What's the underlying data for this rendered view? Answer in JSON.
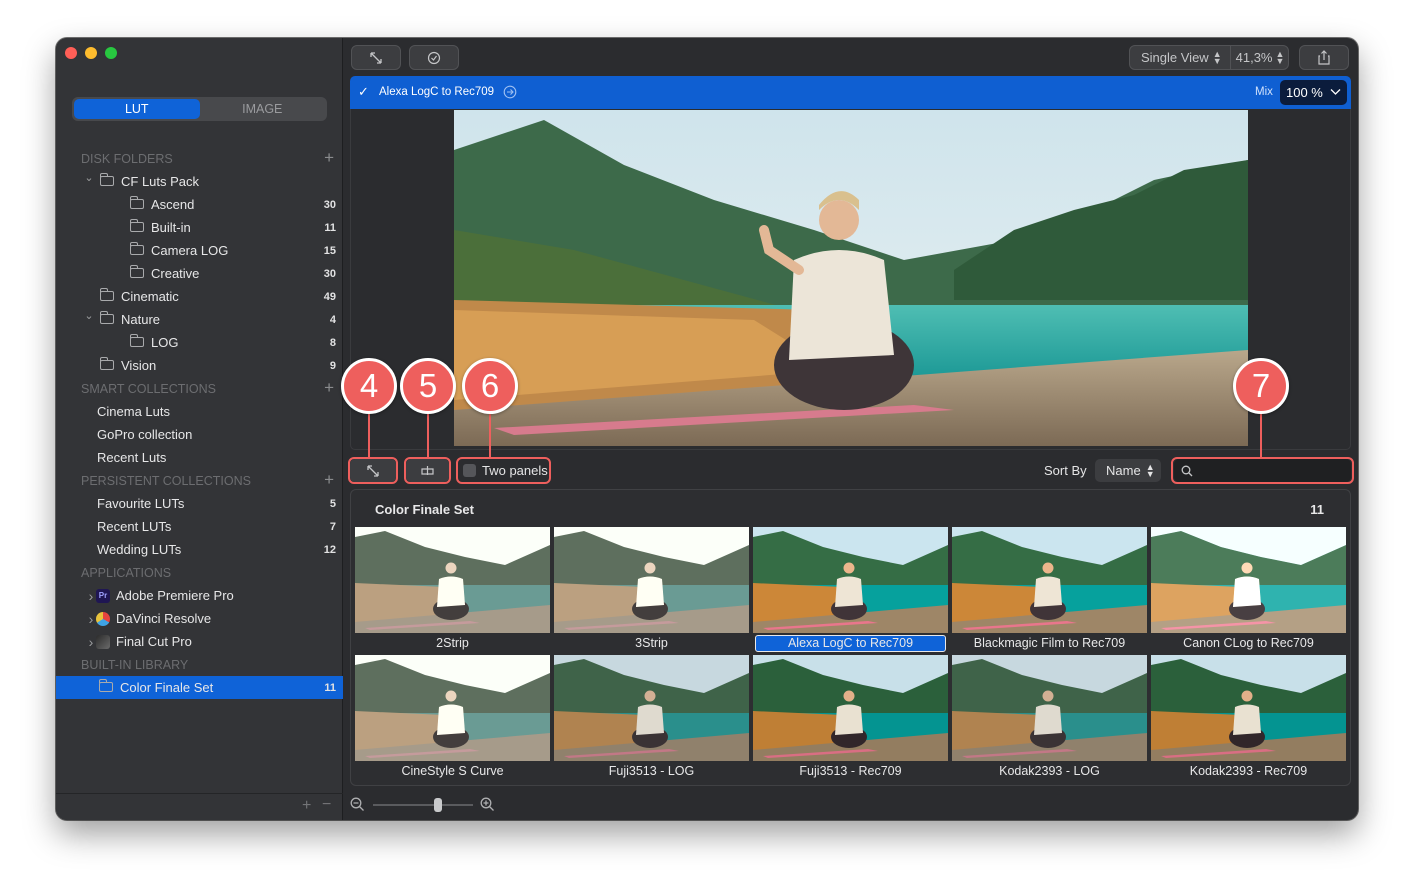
{
  "window": {
    "traffic_lights": [
      "#ff5f57",
      "#febc2e",
      "#28c840"
    ]
  },
  "mode": {
    "lut": "LUT",
    "image": "IMAGE",
    "selected": "LUT"
  },
  "sidebar": {
    "disk_folders": {
      "header": "DISK FOLDERS",
      "items": [
        {
          "label": "CF Luts Pack",
          "count": "",
          "level": 1,
          "disclosure": "open"
        },
        {
          "label": "Ascend",
          "count": "30",
          "level": 2,
          "disclosure": ""
        },
        {
          "label": "Built-in",
          "count": "11",
          "level": 2,
          "disclosure": ""
        },
        {
          "label": "Camera LOG",
          "count": "15",
          "level": 2,
          "disclosure": ""
        },
        {
          "label": "Creative",
          "count": "30",
          "level": 2,
          "disclosure": ""
        },
        {
          "label": "Cinematic",
          "count": "49",
          "level": 1,
          "disclosure": ""
        },
        {
          "label": "Nature",
          "count": "4",
          "level": 1,
          "disclosure": "open"
        },
        {
          "label": "LOG",
          "count": "8",
          "level": 2,
          "disclosure": ""
        },
        {
          "label": "Vision",
          "count": "9",
          "level": 1,
          "disclosure": ""
        }
      ]
    },
    "smart_collections": {
      "header": "SMART COLLECTIONS",
      "items": [
        {
          "label": "Cinema Luts"
        },
        {
          "label": "GoPro collection"
        },
        {
          "label": "Recent Luts"
        }
      ]
    },
    "persistent_collections": {
      "header": "PERSISTENT COLLECTIONS",
      "items": [
        {
          "label": "Favourite LUTs",
          "count": "5"
        },
        {
          "label": "Recent LUTs",
          "count": "7"
        },
        {
          "label": "Wedding LUTs",
          "count": "12"
        }
      ]
    },
    "applications": {
      "header": "APPLICATIONS",
      "items": [
        {
          "label": "Adobe Premiere Pro",
          "icon": "premiere-pro-icon",
          "badge": "Pr"
        },
        {
          "label": "DaVinci Resolve",
          "icon": "davinci-resolve-icon",
          "badge": ""
        },
        {
          "label": "Final Cut Pro",
          "icon": "final-cut-pro-icon",
          "badge": ""
        }
      ]
    },
    "built_in_library": {
      "header": "BUILT-IN LIBRARY",
      "items": [
        {
          "label": "Color Finale Set",
          "count": "11",
          "selected": true
        }
      ]
    },
    "footer": {
      "add": "+",
      "remove": "−"
    }
  },
  "toolbar": {
    "view_mode": "Single View",
    "zoom": "41,3%",
    "icons": [
      "fit-screen-icon",
      "compare-icon",
      "share-icon"
    ]
  },
  "active_lut": {
    "name": "Alexa LogC to Rec709",
    "enabled": true,
    "mix_label": "Mix",
    "mix_value": "100 %"
  },
  "preview_tools": {
    "two_panels_label": "Two panels",
    "two_panels_checked": false,
    "sort_by_label": "Sort By",
    "sort_value": "Name",
    "search_placeholder": ""
  },
  "callouts": [
    "4",
    "5",
    "6",
    "7"
  ],
  "gallery": {
    "title": "Color Finale Set",
    "count": "11",
    "items": [
      {
        "name": "2Strip",
        "tone": "faded"
      },
      {
        "name": "3Strip",
        "tone": "faded"
      },
      {
        "name": "Alexa LogC to Rec709",
        "tone": "vivid",
        "selected": true
      },
      {
        "name": "Blackmagic Film to Rec709",
        "tone": "vivid"
      },
      {
        "name": "Canon CLog to Rec709",
        "tone": "bright"
      },
      {
        "name": "CineStyle S Curve",
        "tone": "faded"
      },
      {
        "name": "Fuji3513 - LOG",
        "tone": "normal"
      },
      {
        "name": "Fuji3513 - Rec709",
        "tone": "contrast"
      },
      {
        "name": "Kodak2393 - LOG",
        "tone": "normal"
      },
      {
        "name": "Kodak2393 - Rec709",
        "tone": "contrast"
      }
    ]
  },
  "colors": {
    "accent": "#0f63d8",
    "callout": "#ee5f5d",
    "window_bg": "#2b2c2f",
    "sidebar_bg": "#333437"
  }
}
